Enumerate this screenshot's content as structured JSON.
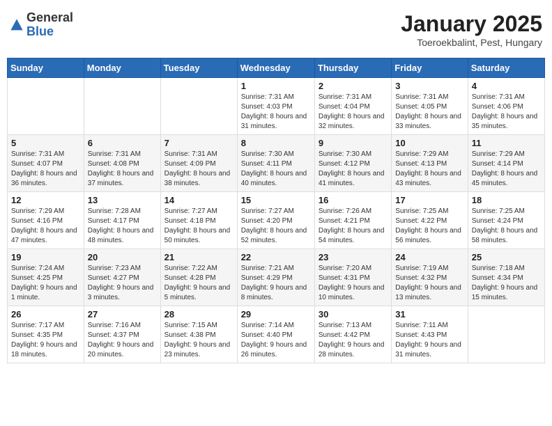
{
  "header": {
    "logo_general": "General",
    "logo_blue": "Blue",
    "month_title": "January 2025",
    "location": "Toeroekbalint, Pest, Hungary"
  },
  "days_of_week": [
    "Sunday",
    "Monday",
    "Tuesday",
    "Wednesday",
    "Thursday",
    "Friday",
    "Saturday"
  ],
  "weeks": [
    [
      {
        "day": "",
        "info": ""
      },
      {
        "day": "",
        "info": ""
      },
      {
        "day": "",
        "info": ""
      },
      {
        "day": "1",
        "info": "Sunrise: 7:31 AM\nSunset: 4:03 PM\nDaylight: 8 hours and 31 minutes."
      },
      {
        "day": "2",
        "info": "Sunrise: 7:31 AM\nSunset: 4:04 PM\nDaylight: 8 hours and 32 minutes."
      },
      {
        "day": "3",
        "info": "Sunrise: 7:31 AM\nSunset: 4:05 PM\nDaylight: 8 hours and 33 minutes."
      },
      {
        "day": "4",
        "info": "Sunrise: 7:31 AM\nSunset: 4:06 PM\nDaylight: 8 hours and 35 minutes."
      }
    ],
    [
      {
        "day": "5",
        "info": "Sunrise: 7:31 AM\nSunset: 4:07 PM\nDaylight: 8 hours and 36 minutes."
      },
      {
        "day": "6",
        "info": "Sunrise: 7:31 AM\nSunset: 4:08 PM\nDaylight: 8 hours and 37 minutes."
      },
      {
        "day": "7",
        "info": "Sunrise: 7:31 AM\nSunset: 4:09 PM\nDaylight: 8 hours and 38 minutes."
      },
      {
        "day": "8",
        "info": "Sunrise: 7:30 AM\nSunset: 4:11 PM\nDaylight: 8 hours and 40 minutes."
      },
      {
        "day": "9",
        "info": "Sunrise: 7:30 AM\nSunset: 4:12 PM\nDaylight: 8 hours and 41 minutes."
      },
      {
        "day": "10",
        "info": "Sunrise: 7:29 AM\nSunset: 4:13 PM\nDaylight: 8 hours and 43 minutes."
      },
      {
        "day": "11",
        "info": "Sunrise: 7:29 AM\nSunset: 4:14 PM\nDaylight: 8 hours and 45 minutes."
      }
    ],
    [
      {
        "day": "12",
        "info": "Sunrise: 7:29 AM\nSunset: 4:16 PM\nDaylight: 8 hours and 47 minutes."
      },
      {
        "day": "13",
        "info": "Sunrise: 7:28 AM\nSunset: 4:17 PM\nDaylight: 8 hours and 48 minutes."
      },
      {
        "day": "14",
        "info": "Sunrise: 7:27 AM\nSunset: 4:18 PM\nDaylight: 8 hours and 50 minutes."
      },
      {
        "day": "15",
        "info": "Sunrise: 7:27 AM\nSunset: 4:20 PM\nDaylight: 8 hours and 52 minutes."
      },
      {
        "day": "16",
        "info": "Sunrise: 7:26 AM\nSunset: 4:21 PM\nDaylight: 8 hours and 54 minutes."
      },
      {
        "day": "17",
        "info": "Sunrise: 7:25 AM\nSunset: 4:22 PM\nDaylight: 8 hours and 56 minutes."
      },
      {
        "day": "18",
        "info": "Sunrise: 7:25 AM\nSunset: 4:24 PM\nDaylight: 8 hours and 58 minutes."
      }
    ],
    [
      {
        "day": "19",
        "info": "Sunrise: 7:24 AM\nSunset: 4:25 PM\nDaylight: 9 hours and 1 minute."
      },
      {
        "day": "20",
        "info": "Sunrise: 7:23 AM\nSunset: 4:27 PM\nDaylight: 9 hours and 3 minutes."
      },
      {
        "day": "21",
        "info": "Sunrise: 7:22 AM\nSunset: 4:28 PM\nDaylight: 9 hours and 5 minutes."
      },
      {
        "day": "22",
        "info": "Sunrise: 7:21 AM\nSunset: 4:29 PM\nDaylight: 9 hours and 8 minutes."
      },
      {
        "day": "23",
        "info": "Sunrise: 7:20 AM\nSunset: 4:31 PM\nDaylight: 9 hours and 10 minutes."
      },
      {
        "day": "24",
        "info": "Sunrise: 7:19 AM\nSunset: 4:32 PM\nDaylight: 9 hours and 13 minutes."
      },
      {
        "day": "25",
        "info": "Sunrise: 7:18 AM\nSunset: 4:34 PM\nDaylight: 9 hours and 15 minutes."
      }
    ],
    [
      {
        "day": "26",
        "info": "Sunrise: 7:17 AM\nSunset: 4:35 PM\nDaylight: 9 hours and 18 minutes."
      },
      {
        "day": "27",
        "info": "Sunrise: 7:16 AM\nSunset: 4:37 PM\nDaylight: 9 hours and 20 minutes."
      },
      {
        "day": "28",
        "info": "Sunrise: 7:15 AM\nSunset: 4:38 PM\nDaylight: 9 hours and 23 minutes."
      },
      {
        "day": "29",
        "info": "Sunrise: 7:14 AM\nSunset: 4:40 PM\nDaylight: 9 hours and 26 minutes."
      },
      {
        "day": "30",
        "info": "Sunrise: 7:13 AM\nSunset: 4:42 PM\nDaylight: 9 hours and 28 minutes."
      },
      {
        "day": "31",
        "info": "Sunrise: 7:11 AM\nSunset: 4:43 PM\nDaylight: 9 hours and 31 minutes."
      },
      {
        "day": "",
        "info": ""
      }
    ]
  ]
}
